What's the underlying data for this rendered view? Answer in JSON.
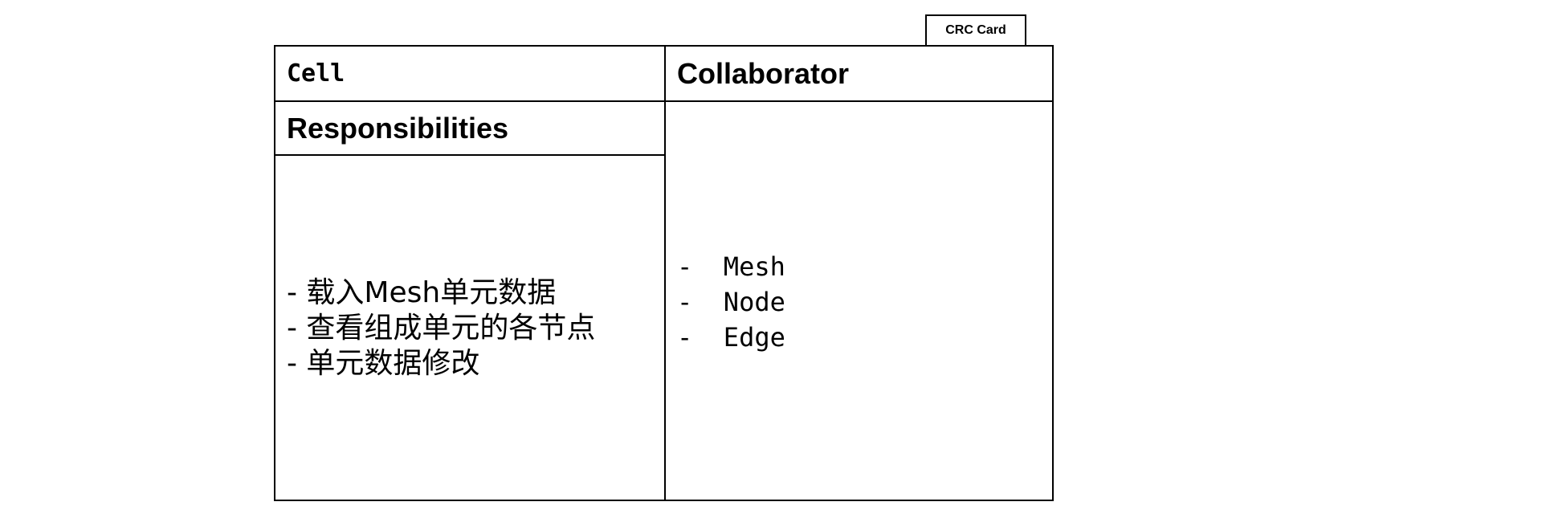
{
  "tab_label": "CRC Card",
  "card": {
    "class_name": "Cell",
    "responsibilities_title": "Responsibilities",
    "collaborator_title": "Collaborator",
    "responsibilities": [
      "- 载入Mesh单元数据",
      "- 查看组成单元的各节点",
      "- 单元数据修改"
    ],
    "collaborators": [
      "-  Mesh",
      "-  Node",
      "-  Edge"
    ]
  }
}
